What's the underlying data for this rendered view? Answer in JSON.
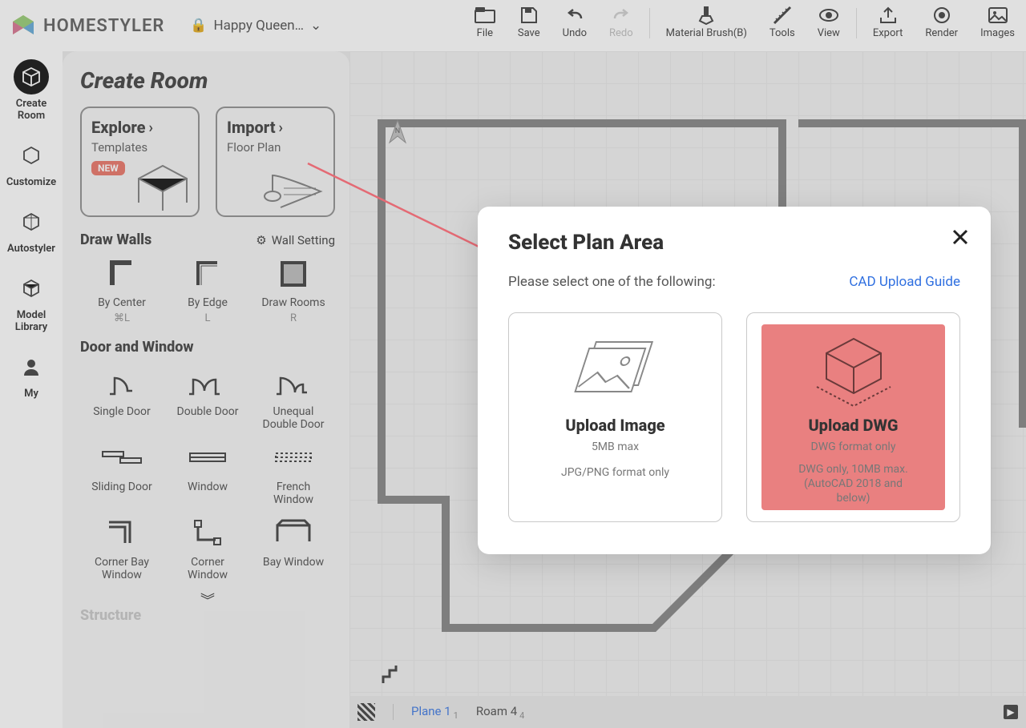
{
  "app": {
    "name": "HOMESTYLER",
    "project_name": "Happy Queen…"
  },
  "topbar": {
    "file": "File",
    "save": "Save",
    "undo": "Undo",
    "redo": "Redo",
    "material_brush": "Material Brush(B)",
    "tools": "Tools",
    "view": "View",
    "export": "Export",
    "render": "Render",
    "images": "Images"
  },
  "rail": {
    "create_room": "Create\nRoom",
    "customize": "Customize",
    "autostyler": "Autostyler",
    "model_library": "Model\nLibrary",
    "my": "My"
  },
  "panel": {
    "title": "Create Room",
    "explore": {
      "title": "Explore",
      "subtitle": "Templates",
      "badge": "NEW"
    },
    "import": {
      "title": "Import",
      "subtitle": "Floor Plan"
    },
    "draw_walls_title": "Draw Walls",
    "wall_setting": "Wall Setting",
    "walls": {
      "by_center": {
        "label": "By Center",
        "key": "⌘L"
      },
      "by_edge": {
        "label": "By Edge",
        "key": "L"
      },
      "draw_rooms": {
        "label": "Draw Rooms",
        "key": "R"
      }
    },
    "dw_title": "Door and Window",
    "dw": {
      "single_door": "Single Door",
      "double_door": "Double Door",
      "unequal_double_door": "Unequal\nDouble Door",
      "sliding_door": "Sliding Door",
      "window": "Window",
      "french_window": "French\nWindow",
      "corner_bay_window": "Corner Bay\nWindow",
      "corner_window": "Corner\nWindow",
      "bay_window": "Bay Window"
    },
    "structure_title": "Structure"
  },
  "footer": {
    "plane": "Plane 1",
    "plane_sub": "1",
    "roam": "Roam 4",
    "roam_sub": "4"
  },
  "modal": {
    "title": "Select Plan Area",
    "hint": "Please select one of the following:",
    "guide": "CAD Upload Guide",
    "upload_image": {
      "title": "Upload Image",
      "sub1": "5MB max",
      "sub2": "JPG/PNG format only"
    },
    "upload_dwg": {
      "title": "Upload DWG",
      "sub1": "DWG format only",
      "sub2": "DWG only, 10MB max.\n(AutoCAD 2018 and\nbelow)"
    }
  }
}
